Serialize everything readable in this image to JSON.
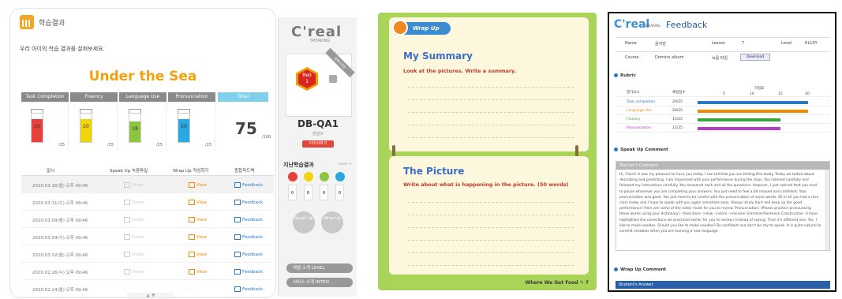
{
  "p1": {
    "header": "학습결과",
    "subtitle": "우리 아이의 학습 결과를 살펴보세요.",
    "title": "Under the Sea",
    "scores": [
      {
        "label": "Task Completion",
        "value": "20",
        "of": "/25",
        "color": "#e8413b"
      },
      {
        "label": "Fluency",
        "value": "20",
        "of": "/25",
        "color": "#f2d40c"
      },
      {
        "label": "Language Use",
        "value": "18",
        "of": "/25",
        "color": "#8cc63f"
      },
      {
        "label": "Pronunciation",
        "value": "20",
        "of": "/25",
        "color": "#2aa8e0"
      }
    ],
    "total_label": "Total",
    "total": "75",
    "total_of": "/100",
    "columns": [
      "일시",
      "Speak Up 녹음파일",
      "Wrap Up 작성하기",
      "종합피드백"
    ],
    "rows": [
      [
        "2020.03.16(월) 오후 09:46",
        "Down",
        "View",
        "Feedback"
      ],
      [
        "2020.03.11(수) 오후 09:46",
        "Down",
        "View",
        "Feedback"
      ],
      [
        "2020.03.09(월) 오후 09:46",
        "Down",
        "View",
        "Feedback"
      ],
      [
        "2020.03.04(수) 오후 09:46",
        "Down",
        "View",
        "Feedback"
      ],
      [
        "2020.03.02(월) 오후 09:46",
        "Down",
        "View",
        "Feedback"
      ],
      [
        "2020.02.26(수) 오후 09:46",
        "Down",
        "View",
        "Feedback"
      ],
      [
        "2020.02.24(월) 오후 09:46",
        "-",
        "-",
        "Feedback"
      ]
    ]
  },
  "p2": {
    "logo": "C'real",
    "logo_sub": "SPEAKING",
    "badge_level": "Red",
    "badge_num": "1",
    "ribbon": "올레스피킹",
    "code": "DB-QA1",
    "code_sub": "한살수",
    "btn": "이어서하기",
    "prev": "지난학습결과",
    "more": "more +",
    "speak": "Speak Up",
    "wrap": "Wrap Up",
    "levels": "레벨 소개  LEVEL",
    "service": "서비스 소개  INTRO"
  },
  "p3": {
    "tag": "Wrap Up",
    "h1": "My Summary",
    "inst1": "Look at the pictures. Write a summary.",
    "h2": "The Picture",
    "inst2": "Write about what is happening in the picture. (50 words)",
    "footer": "Where We Get Food",
    "page": "7"
  },
  "p4": {
    "logo": "C'real",
    "logo_sub": "SPEAKING",
    "title": "Feedback",
    "info1": [
      "Name",
      "윤지현",
      "Lesson",
      "7",
      "Level",
      "RL10Y"
    ],
    "info2": [
      "Course",
      "Domino album",
      "녹음 파일",
      "Download"
    ],
    "rubric_label": "Rubric",
    "rubric_cols": [
      "평가요소",
      "채점점수",
      "학점표"
    ],
    "ticks": [
      "5",
      "10",
      "15",
      "20"
    ],
    "rubric": [
      {
        "name": "Task completion",
        "score": "20/25",
        "pct": 1.0,
        "color": "#2b78c5"
      },
      {
        "name": "Language Use",
        "score": "20/25",
        "pct": 1.0,
        "color": "#f08a00"
      },
      {
        "name": "Fluency",
        "score": "15/25",
        "pct": 0.75,
        "color": "#3aa53a"
      },
      {
        "name": "Pronunciation",
        "score": "15/25",
        "pct": 0.75,
        "color": "#b63ac8"
      }
    ],
    "speak_label": "Speak Up Comment",
    "comment_title": "Teacher's Comment",
    "comment": "Hi, Claire! It was my pleasure to have you today. I can tell that you are feeling fine today. Today we talked about describing and predicting. I am impressed with your performance during the class. You listened carefully and followed my instructions carefully. You answered each and all the questions. However, I just noticed that you tend to pause whenever you are completing your answers. You just need to feel a bit relaxed and confident. Your pronunciation was good. You just need to be careful with the pronunciation of some words. All in all you had a nice class today and I hope to speak with you again sometime soon. Always study hard and keep up the good performance! Here are some of the notes I took for you to review. Pronunciation: (Please practice pronouncing these words using your dictionary) - food,store ->look ->store ->receive Grammar/Sentence Construction: (I have highlighted the corrections we practiced earlier for you to review.) Instead of saying: Then it's different one. Yes, I like to make noodles. Should you like to make noodles? Be confident and don't be shy to speak. It is quite natural to commit mistakes when you are learning a new language.",
    "wrap_label": "Wrap Up Comment",
    "student": "Student's Answer"
  }
}
